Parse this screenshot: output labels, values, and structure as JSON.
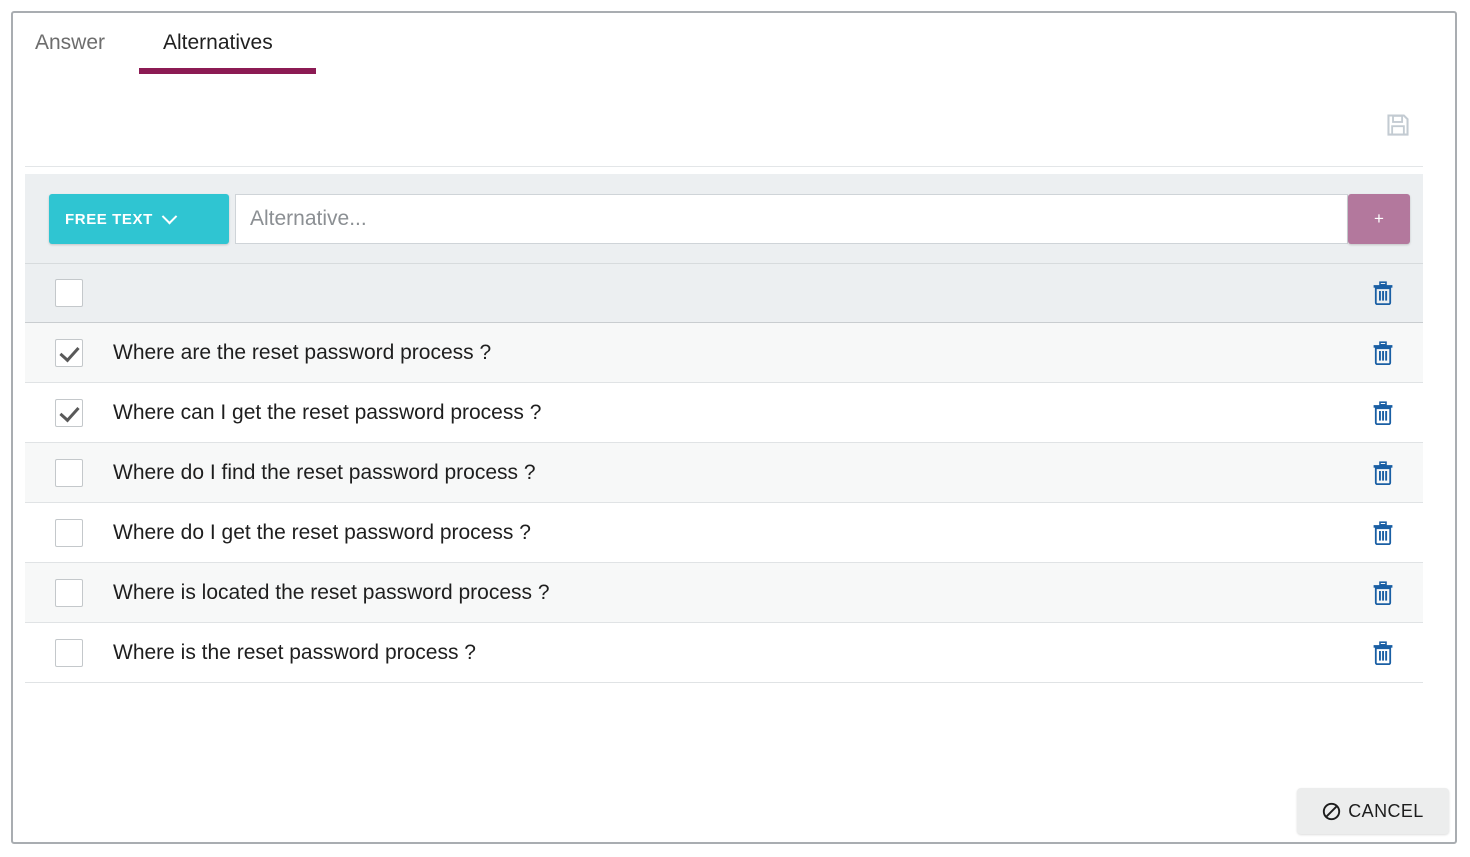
{
  "tabs": [
    {
      "label": "Answer",
      "active": false,
      "name": "tab-answer"
    },
    {
      "label": "Alternatives",
      "active": true,
      "name": "tab-alternatives"
    }
  ],
  "toolbar": {
    "save_icon": "save-floppy-icon",
    "type_label": "FREE TEXT",
    "dropdown_icon": "chevron-down-icon",
    "input_placeholder": "Alternative...",
    "input_value": "",
    "add_label": "+"
  },
  "table": {
    "header": {
      "checkbox_checked": false,
      "delete_icon": "trash-icon"
    },
    "rows": [
      {
        "text": "Where are the reset password process ?",
        "checked": true
      },
      {
        "text": "Where can I get the reset password process ?",
        "checked": true
      },
      {
        "text": "Where do I find the reset password process ?",
        "checked": false
      },
      {
        "text": "Where do I get the reset password process ?",
        "checked": false
      },
      {
        "text": "Where is located the reset password process ?",
        "checked": false
      },
      {
        "text": "Where is the reset password process ?",
        "checked": false
      }
    ]
  },
  "footer": {
    "cancel_label": "CANCEL",
    "cancel_icon": "ban-icon"
  },
  "colors": {
    "tab_active_underline": "#8c1b54",
    "type_button": "#2fc5d2",
    "add_button": "#b3789d",
    "trash_icon": "#1a5fa4",
    "toolbar_band": "#eceff1"
  }
}
